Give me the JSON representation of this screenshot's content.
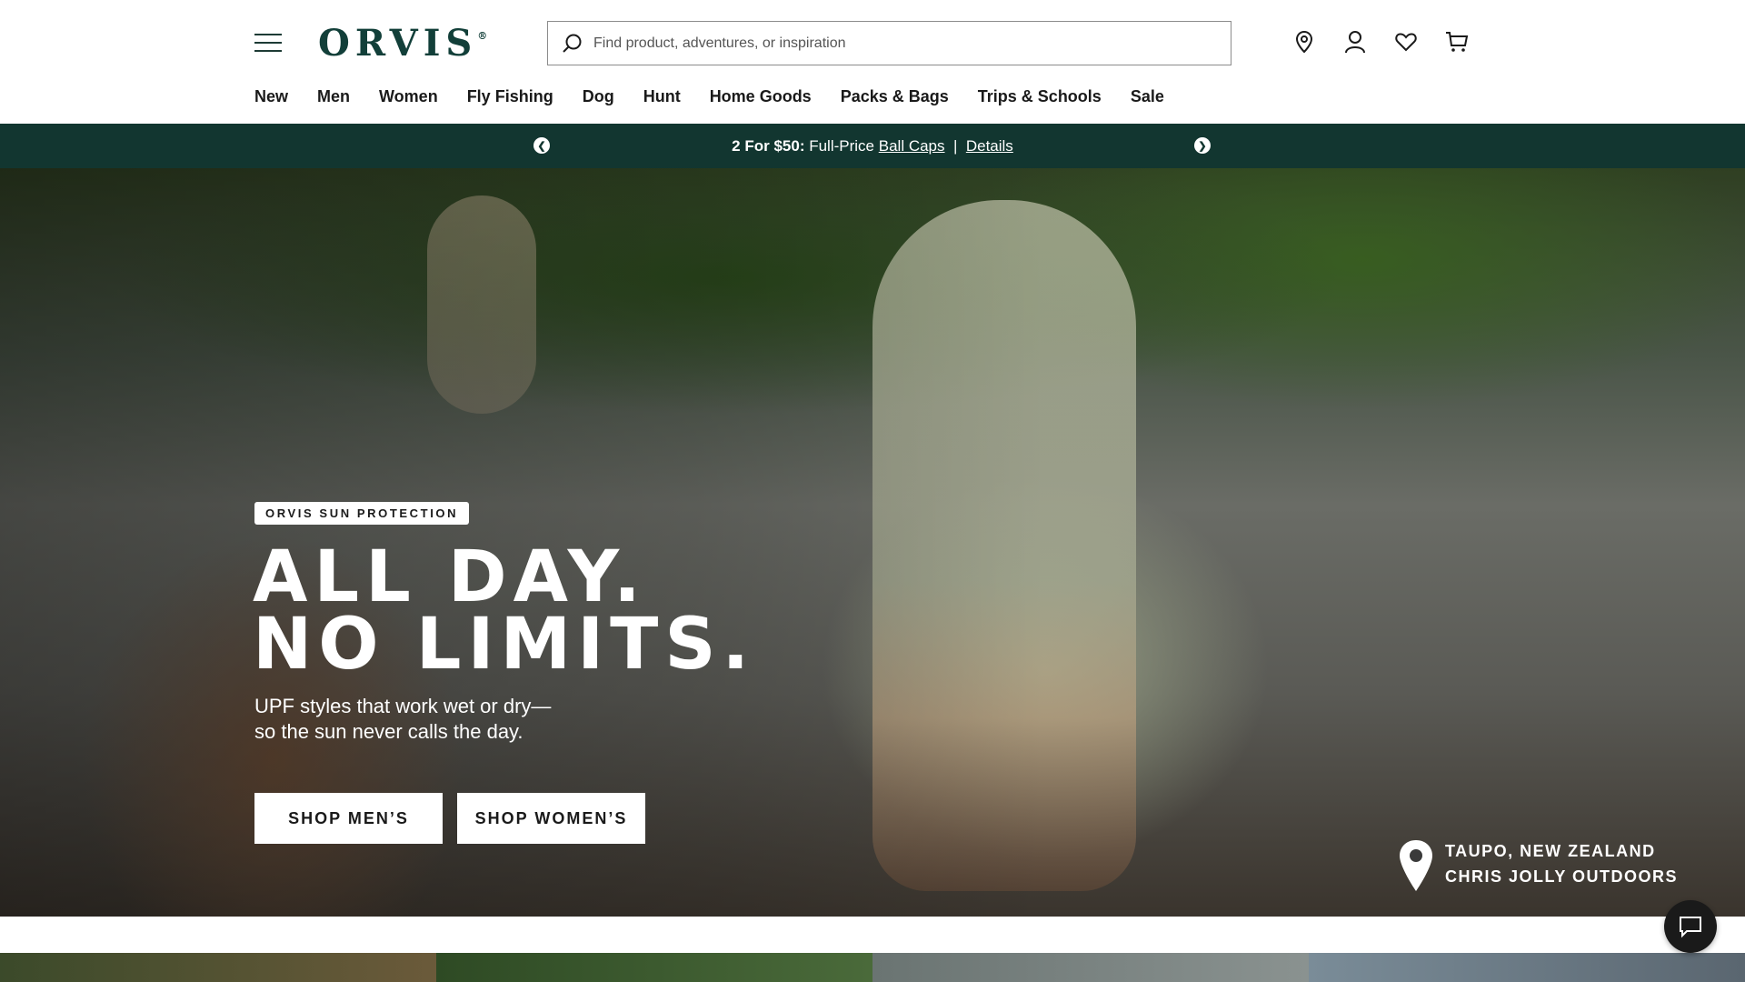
{
  "header": {
    "logo_text": "ORVIS",
    "logo_mark": "®",
    "search_placeholder": "Find product, adventures, or inspiration",
    "icons": [
      "menu-icon",
      "search-icon",
      "location-pin-icon",
      "account-icon",
      "heart-icon",
      "cart-icon"
    ]
  },
  "nav": {
    "items": [
      "New",
      "Men",
      "Women",
      "Fly Fishing",
      "Dog",
      "Hunt",
      "Home Goods",
      "Packs & Bags",
      "Trips & Schools",
      "Sale"
    ]
  },
  "promo": {
    "bold": "2 For $50:",
    "text": "Full-Price",
    "link": "Ball Caps",
    "separator": "|",
    "details": "Details",
    "prev_icon": "chevron-left-icon",
    "next_icon": "chevron-right-icon"
  },
  "hero": {
    "badge": "ORVIS SUN PROTECTION",
    "headline_line1": "ALL DAY.",
    "headline_line2": "NO LIMITS.",
    "sub_line1": "UPF styles that work wet or dry—",
    "sub_line2": "so the sun never calls the day.",
    "button_men": "SHOP MEN’S",
    "button_women": "SHOP WOMEN’S",
    "location_line1": "TAUPO, NEW ZEALAND",
    "location_line2": "CHRIS JOLLY OUTDOORS"
  },
  "colors": {
    "brand_green": "#123f39",
    "promo_bg": "#123630"
  }
}
